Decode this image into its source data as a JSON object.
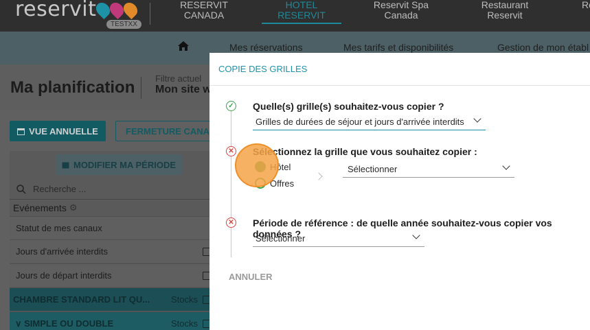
{
  "topbar": {
    "logo": "reservit",
    "badge": "TESTXX",
    "nav": [
      {
        "line1": "RESERVIT",
        "line2": "CANADA"
      },
      {
        "line1": "HOTEL",
        "line2": "RESERVIT"
      },
      {
        "line1": "Reservit Spa",
        "line2": "Canada"
      },
      {
        "line1": "Restaurant",
        "line2": "Reservit"
      },
      {
        "line1": "Re",
        "line2": ""
      }
    ]
  },
  "subnav": {
    "items": [
      "Mes réservations",
      "Mes tarifs et disponibilités",
      "Gestion de mon établ"
    ]
  },
  "page": {
    "title": "Ma planification",
    "filter_label": "Filtre actuel",
    "filter_value": "Mon site w",
    "btn_annual": "VUE ANNUELLE",
    "btn_closing": "FERMETURE CANAUX",
    "btn_modify": "MODIFIER MA PÉRIODE",
    "search_placeholder": "Recherche ...",
    "events_label": "Evénements",
    "rows": [
      "Statut de mes canaux",
      "Jours d'arrivée interdits",
      "Jours de départ interdits"
    ],
    "room1": "CHAMBRE STANDARD LIT QU...",
    "room2": "SIMPLE OU DOUBLE",
    "stocks": "Stocks"
  },
  "modal": {
    "title": "COPIE DES GRILLES",
    "q1": "Quelle(s) grille(s) souhaitez-vous copier ?",
    "q1_value": "Grilles de durées de séjour et jours d'arrivée interdits",
    "q2": "Sélectionnez la grille que vous souhaitez copier :",
    "radio_hotel": "Hôtel",
    "radio_offres": "Offres",
    "q2_select": "Sélectionner",
    "q3": "Période de référence : de quelle année souhaitez-vous copier vos données ?",
    "q3_select": "Sélectionner",
    "cancel": "ANNULER"
  },
  "colors": {
    "accent": "#1e93a8",
    "success": "#3aa34a",
    "error": "#d9443f",
    "highlight": "#f6a346"
  }
}
